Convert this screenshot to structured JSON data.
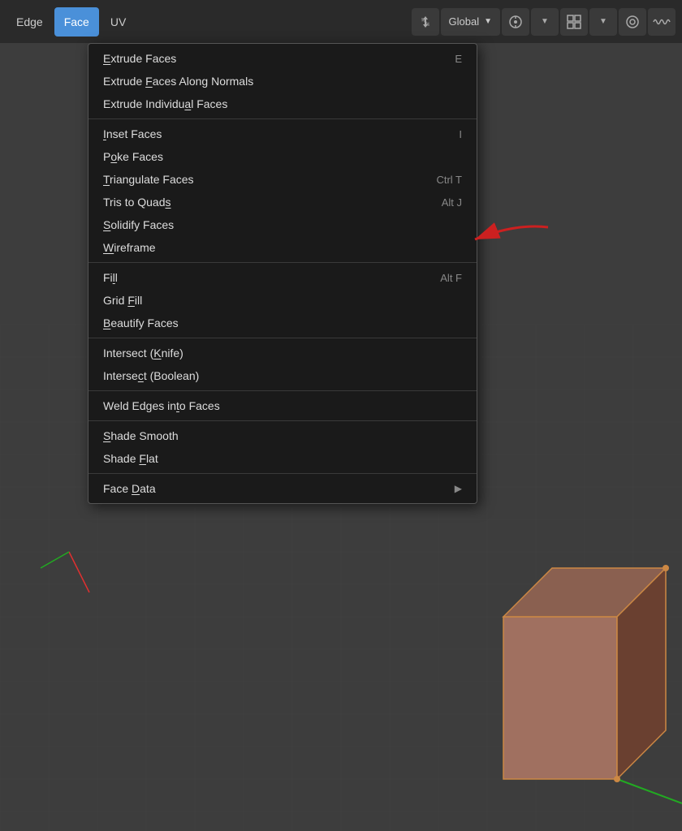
{
  "toolbar": {
    "edge_label": "Edge",
    "face_label": "Face",
    "uv_label": "UV",
    "transform_icon": "↻",
    "global_label": "Global",
    "pivot_icon": "⊕",
    "snap_icon": "⊞",
    "proportional_icon": "◎",
    "wave_icon": "∿"
  },
  "menu": {
    "title": "Face",
    "groups": [
      {
        "items": [
          {
            "label": "Extrude Faces",
            "underline_index": 0,
            "shortcut": "E",
            "has_arrow": false
          },
          {
            "label": "Extrude Faces Along Normals",
            "underline_index": 7,
            "shortcut": "",
            "has_arrow": false
          },
          {
            "label": "Extrude Individual Faces",
            "underline_index": 8,
            "shortcut": "",
            "has_arrow": false
          }
        ]
      },
      {
        "items": [
          {
            "label": "Inset Faces",
            "underline_index": 0,
            "shortcut": "I",
            "has_arrow": false
          },
          {
            "label": "Poke Faces",
            "underline_index": 1,
            "shortcut": "",
            "has_arrow": false
          },
          {
            "label": "Triangulate Faces",
            "underline_index": 0,
            "shortcut": "Ctrl T",
            "has_arrow": false
          },
          {
            "label": "Tris to Quads",
            "underline_index": 8,
            "shortcut": "Alt J",
            "has_arrow": false
          },
          {
            "label": "Solidify Faces",
            "underline_index": 0,
            "shortcut": "",
            "has_arrow": false
          },
          {
            "label": "Wireframe",
            "underline_index": 0,
            "shortcut": "",
            "has_arrow": false
          }
        ]
      },
      {
        "items": [
          {
            "label": "Fill",
            "underline_index": 3,
            "shortcut": "Alt F",
            "has_arrow": false
          },
          {
            "label": "Grid Fill",
            "underline_index": 5,
            "shortcut": "",
            "has_arrow": false
          },
          {
            "label": "Beautify Faces",
            "underline_index": 0,
            "shortcut": "",
            "has_arrow": false
          }
        ]
      },
      {
        "items": [
          {
            "label": "Intersect (Knife)",
            "underline_index": 10,
            "shortcut": "",
            "has_arrow": false
          },
          {
            "label": "Intersect (Boolean)",
            "underline_index": 10,
            "shortcut": "",
            "has_arrow": false
          }
        ]
      },
      {
        "items": [
          {
            "label": "Weld Edges into Faces",
            "underline_index": 12,
            "shortcut": "",
            "has_arrow": false
          }
        ]
      },
      {
        "items": [
          {
            "label": "Shade Smooth",
            "underline_index": 0,
            "shortcut": "",
            "has_arrow": false
          },
          {
            "label": "Shade Flat",
            "underline_index": 0,
            "shortcut": "",
            "has_arrow": false
          }
        ]
      },
      {
        "items": [
          {
            "label": "Face Data",
            "underline_index": 5,
            "shortcut": "",
            "has_arrow": true
          }
        ]
      }
    ]
  }
}
